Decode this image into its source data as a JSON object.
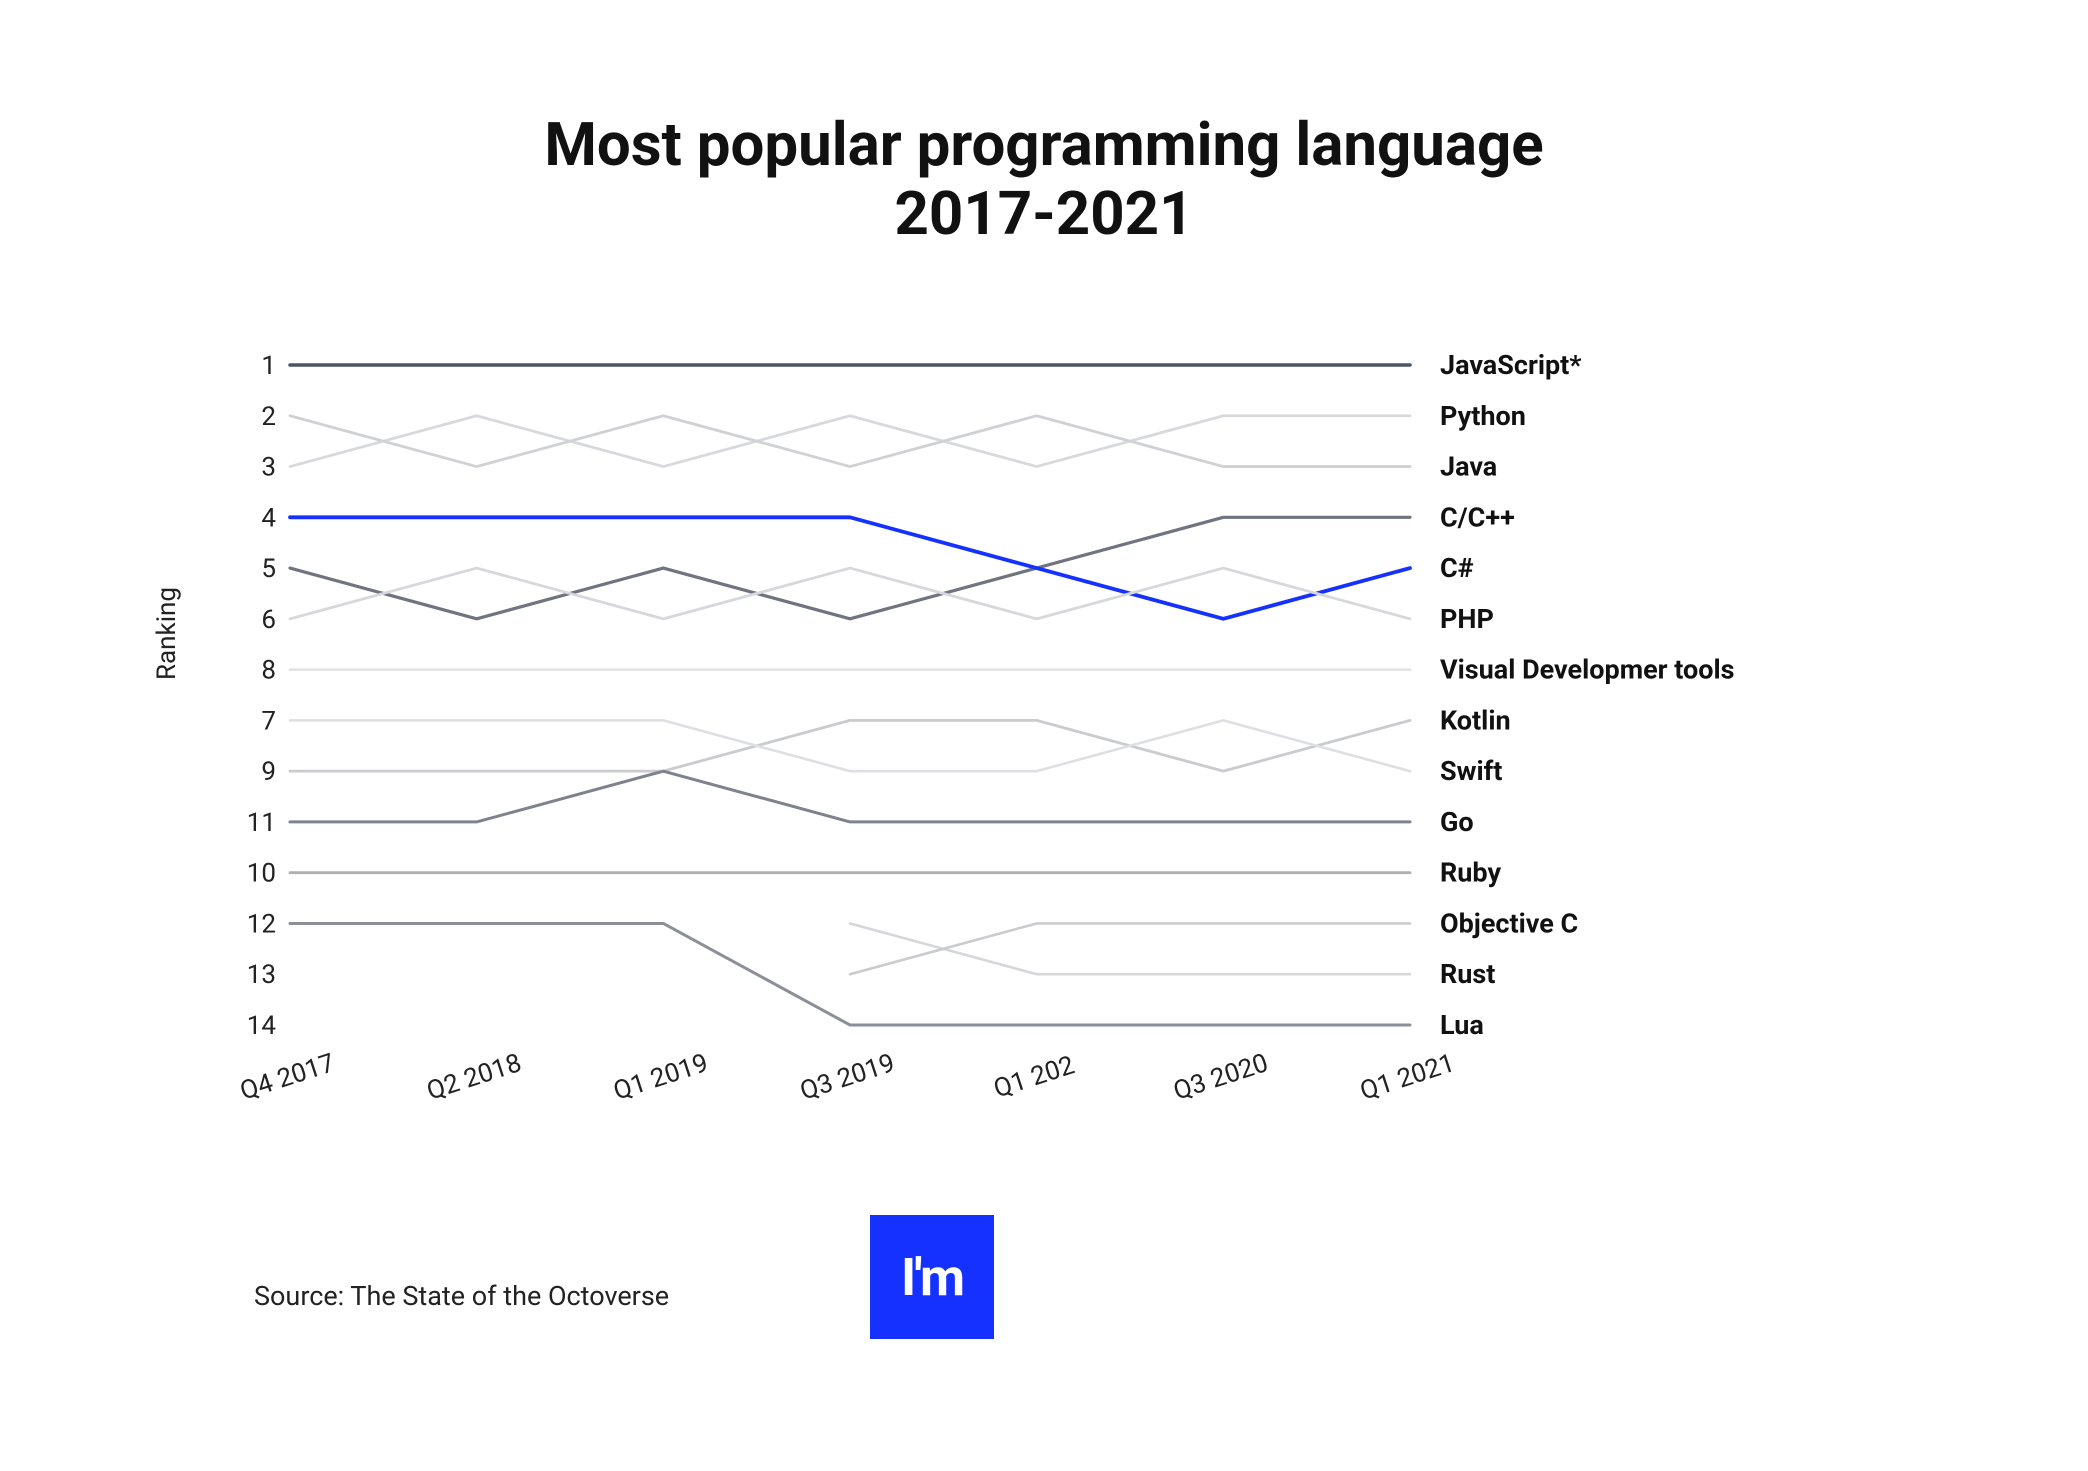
{
  "title_line1": "Most popular programming language",
  "title_line2": "2017-2021",
  "ylabel": "Ranking",
  "source": "Source: The State of the Octoverse",
  "logo_text": "I'm",
  "chart_data": {
    "type": "line",
    "xlabel": "",
    "ylabel": "Ranking",
    "x_categories": [
      "Q4 2017",
      "Q2 2018",
      "Q1 2019",
      "Q3 2019",
      "Q1 202",
      "Q3 2020",
      "Q1 2021"
    ],
    "y_ticks": [
      1,
      2,
      3,
      4,
      5,
      6,
      8,
      7,
      9,
      11,
      10,
      12,
      13,
      14
    ],
    "y_positions": {
      "1": 0,
      "2": 1,
      "3": 2,
      "4": 3,
      "5": 4,
      "6": 5,
      "8": 6,
      "7": 7,
      "9": 8,
      "11": 9,
      "10": 10,
      "12": 11,
      "13": 12,
      "14": 13
    },
    "n_rows": 14,
    "series": [
      {
        "name": "JavaScript*",
        "color": "#4b5563",
        "weight": 3.5,
        "values": [
          1,
          1,
          1,
          1,
          1,
          1,
          1
        ]
      },
      {
        "name": "Python",
        "color": "#d7d9dc",
        "weight": 2.8,
        "values": [
          3,
          2,
          3,
          2,
          3,
          2,
          2
        ]
      },
      {
        "name": "Java",
        "color": "#cfd1d4",
        "weight": 2.8,
        "values": [
          2,
          3,
          2,
          3,
          2,
          3,
          3
        ]
      },
      {
        "name": "C/C++",
        "color": "#6f7480",
        "weight": 3.2,
        "values": [
          5,
          6,
          5,
          6,
          5,
          4,
          4
        ]
      },
      {
        "name": "C#",
        "color": "#1431ff",
        "weight": 3.8,
        "values": [
          4,
          4,
          4,
          4,
          5,
          6,
          5
        ]
      },
      {
        "name": "PHP",
        "color": "#d6d8db",
        "weight": 2.8,
        "values": [
          6,
          5,
          6,
          5,
          6,
          5,
          6
        ]
      },
      {
        "name": "Visual Developmer tools",
        "color": "#e1e2e5",
        "weight": 2.6,
        "values": [
          8,
          8,
          8,
          8,
          8,
          8,
          8
        ]
      },
      {
        "name": "Kotlin",
        "color": "#c9cbce",
        "weight": 2.8,
        "values": [
          9,
          9,
          9,
          7,
          7,
          9,
          7
        ]
      },
      {
        "name": "Swift",
        "color": "#dddfe2",
        "weight": 2.6,
        "values": [
          7,
          7,
          7,
          9,
          9,
          7,
          9
        ]
      },
      {
        "name": "Go",
        "color": "#7d828c",
        "weight": 3.0,
        "values": [
          11,
          11,
          9,
          11,
          11,
          11,
          11
        ]
      },
      {
        "name": "Ruby",
        "color": "#aeb0b4",
        "weight": 2.8,
        "values": [
          10,
          10,
          10,
          10,
          10,
          10,
          10
        ]
      },
      {
        "name": "Objective C",
        "color": "#8b8f98",
        "weight": 3.0,
        "values": [
          12,
          12,
          12,
          14,
          14,
          14,
          14
        ]
      },
      {
        "name": "Rust",
        "color": "#d5d7da",
        "weight": 2.6,
        "values": [
          null,
          null,
          null,
          12,
          13,
          13,
          13
        ]
      },
      {
        "name": "Lua",
        "color": "#c9cbce",
        "weight": 2.6,
        "values": [
          null,
          null,
          null,
          13,
          12,
          12,
          12
        ]
      }
    ],
    "right_labels_order": [
      "JavaScript*",
      "Python",
      "Java",
      "C/C++",
      "C#",
      "PHP",
      "Visual Developmer tools",
      "Kotlin",
      "Swift",
      "Go",
      "Ruby",
      "Objective C",
      "Rust",
      "Lua"
    ]
  }
}
